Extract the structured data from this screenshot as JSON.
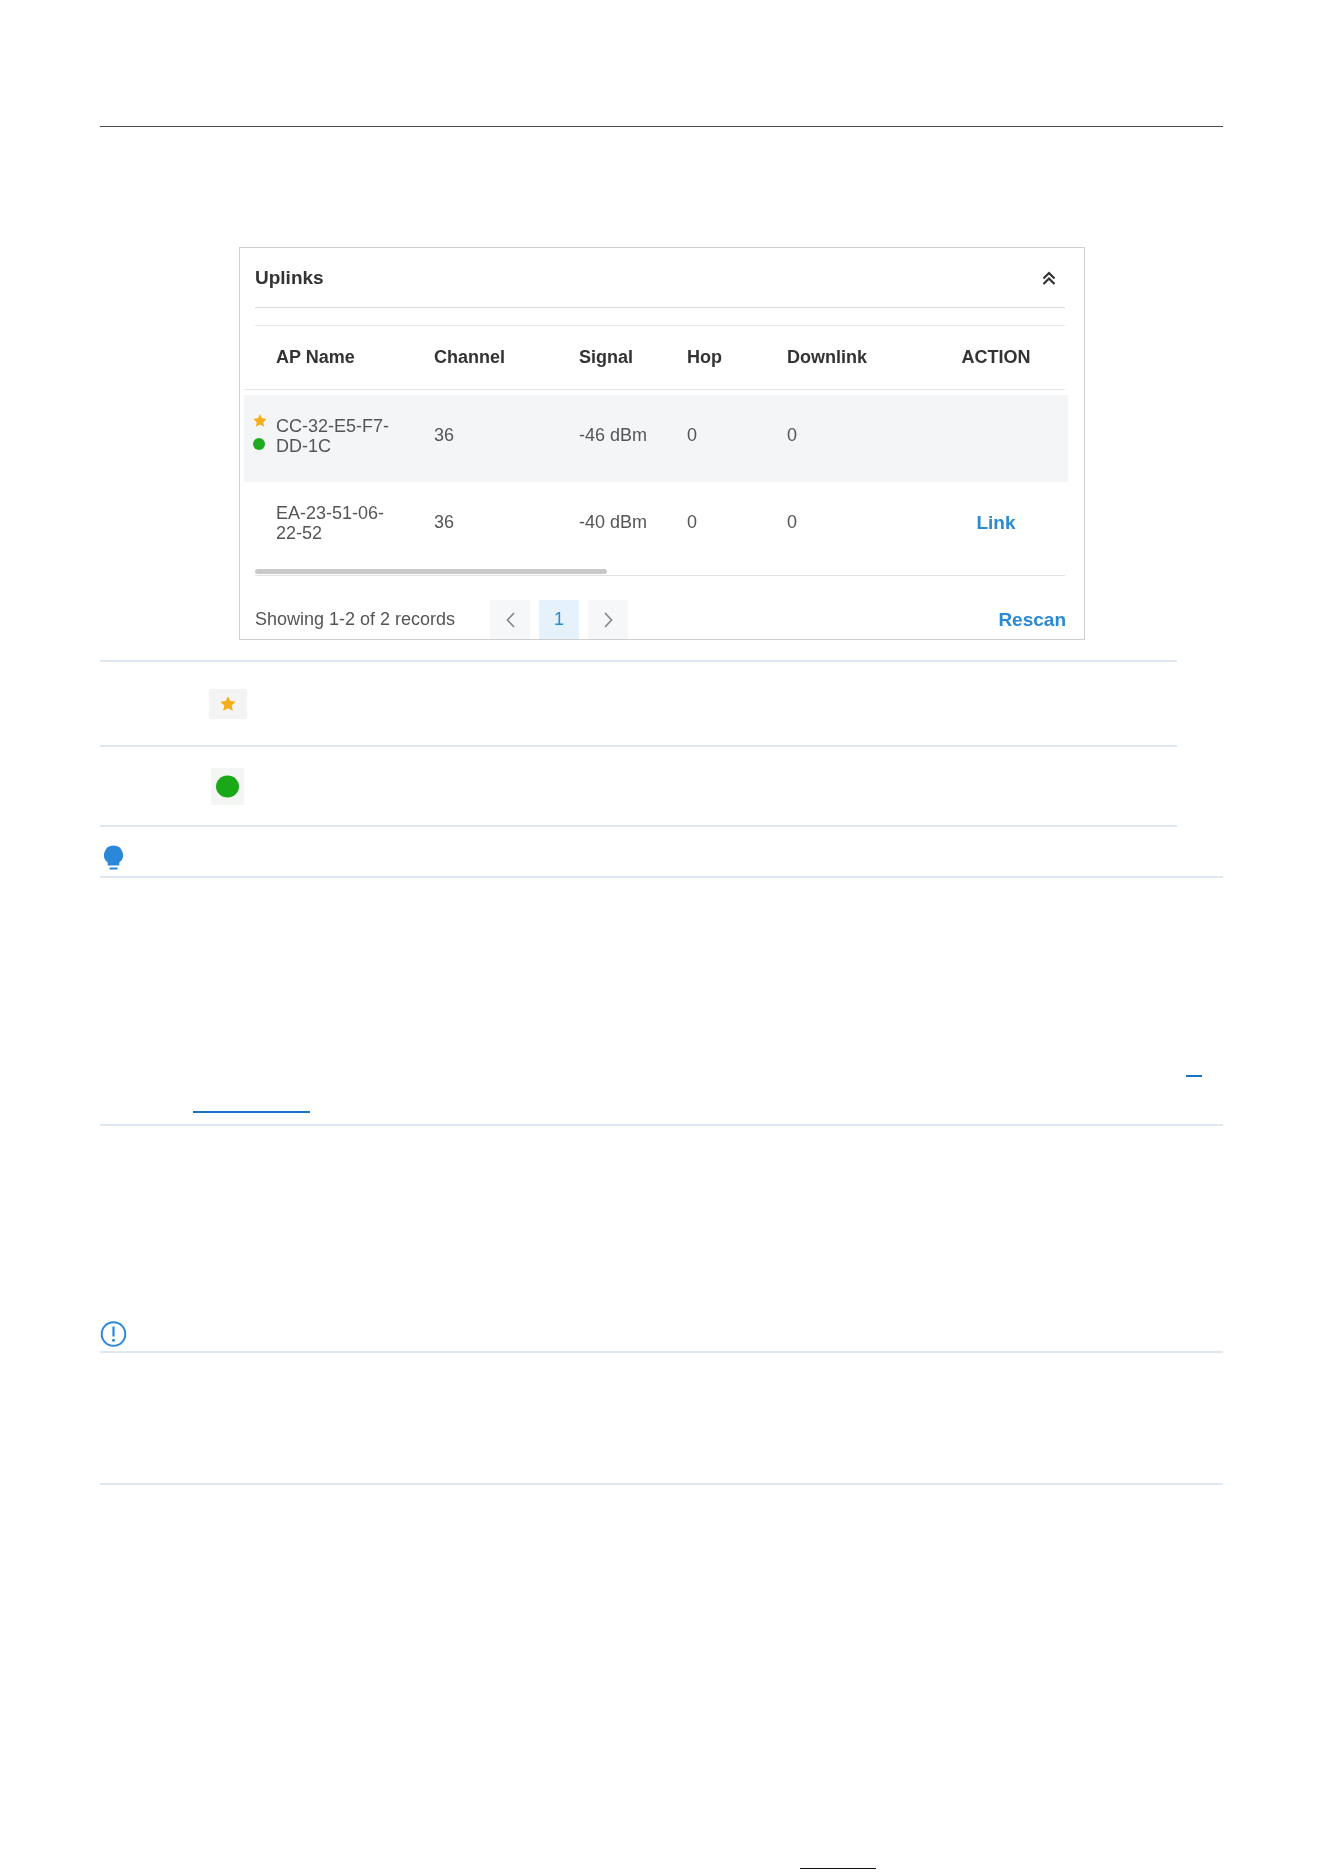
{
  "uplinks_panel": {
    "title": "Uplinks",
    "table": {
      "columns": [
        "AP Name",
        "Channel",
        "Signal",
        "Hop",
        "Downlink",
        "ACTION"
      ],
      "rows": [
        {
          "selected": true,
          "starred": true,
          "connected": true,
          "ap_name": "CC-32-E5-F7-DD-1C",
          "channel": "36",
          "signal": "-46 dBm",
          "hop": "0",
          "downlink": "0"
        },
        {
          "selected": false,
          "starred": false,
          "connected": false,
          "ap_name": "EA-23-51-06-22-52",
          "channel": "36",
          "signal": "-40 dBm",
          "hop": "0",
          "downlink": "0",
          "action": "Link"
        }
      ]
    },
    "footer": {
      "record_count": "Showing 1-2 of 2 records",
      "pages": [
        {
          "label": "1",
          "selected": true
        }
      ],
      "rescan": "Rescan"
    }
  },
  "legend_rows": [
    {
      "kind": "star"
    },
    {
      "kind": "dot"
    }
  ],
  "callouts": [
    {
      "kind": "tip"
    },
    {
      "kind": "note"
    }
  ]
}
